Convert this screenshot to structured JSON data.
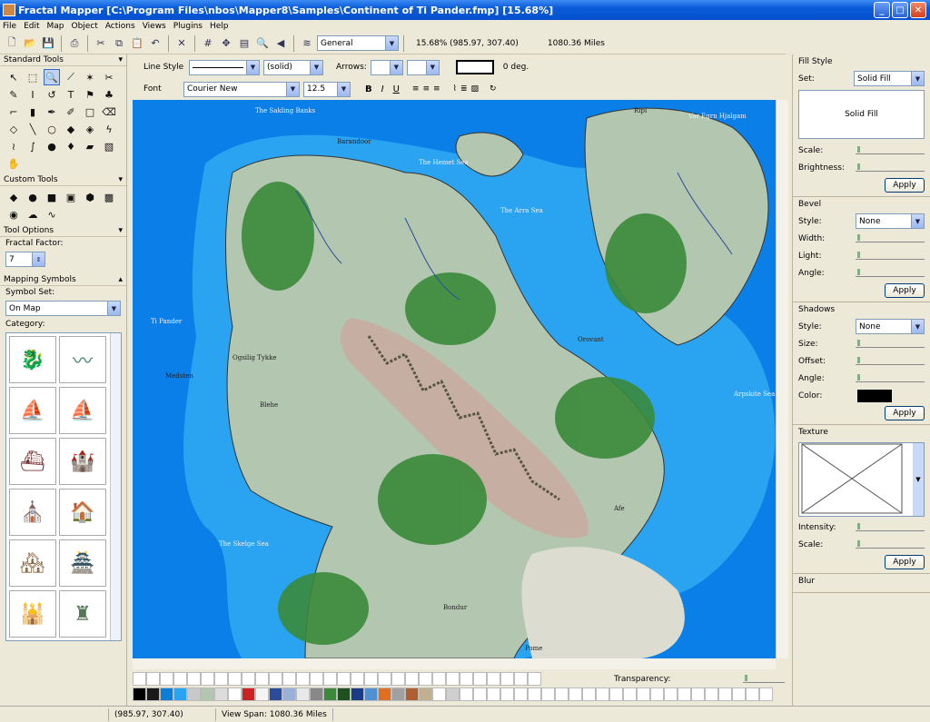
{
  "window": {
    "title": "Fractal Mapper [C:\\Program Files\\nbos\\Mapper8\\Samples\\Continent of Ti Pander.fmp] [15.68%]"
  },
  "menu": [
    "File",
    "Edit",
    "Map",
    "Object",
    "Actions",
    "Views",
    "Plugins",
    "Help"
  ],
  "toolbar": {
    "layer": "General",
    "readout": "15.68%  (985.97, 307.40)",
    "miles": "1080.36 Miles"
  },
  "format": {
    "line_style_label": "Line Style",
    "style_value": "(solid)",
    "arrows_label": "Arrows:",
    "angle": "0 deg.",
    "font_label": "Font",
    "font_value": "Courier New",
    "size_value": "12.5"
  },
  "left": {
    "standard_tools": "Standard Tools",
    "custom_tools": "Custom Tools",
    "tool_options": "Tool Options",
    "fractal_factor": "Fractal Factor:",
    "fractal_value": "7",
    "mapping_symbols": "Mapping Symbols",
    "symbol_set_label": "Symbol Set:",
    "symbol_set_value": "On Map",
    "category_label": "Category:",
    "favorite": "favorite",
    "random": "random"
  },
  "map_labels": [
    "The Sakling Banks",
    "Barandoor",
    "The Hemet Sea",
    "The Arra Sea",
    "Var Egrn Hjalgam",
    "Ripi",
    "Ti Pander",
    "Medsten",
    "Ogsilig Tykke",
    "Blehe",
    "Orovant",
    "Arpskite Sea",
    "The Skelge Sea",
    "Afe",
    "Pome",
    "Bondur"
  ],
  "bottom": {
    "transparency": "Transparency:"
  },
  "right": {
    "fill_style": "Fill Style",
    "set_label": "Set:",
    "set_value": "Solid Fill",
    "preview": "Solid Fill",
    "scale": "Scale:",
    "brightness": "Brightness:",
    "apply": "Apply",
    "bevel": "Bevel",
    "style": "Style:",
    "none": "None",
    "width": "Width:",
    "light": "Light:",
    "angle": "Angle:",
    "shadows": "Shadows",
    "size": "Size:",
    "offset": "Offset:",
    "color": "Color:",
    "texture": "Texture",
    "intensity": "Intensity:",
    "blur": "Blur"
  },
  "status": {
    "coords": "(985.97, 307.40)",
    "span": "View Span: 1080.36 Miles"
  },
  "colors": {
    "palette": [
      "#000000",
      "#1a1a1a",
      "#0a7ed8",
      "#2aa4f0",
      "#c8c8c8",
      "#b3c6b0",
      "#dcdcdc",
      "#ffffff",
      "#cc2222",
      "#f4f4f4",
      "#2b4c9c",
      "#9ab0d8",
      "#e8e8e8",
      "#888888",
      "#3a8a3a",
      "#205020",
      "#1a3a8a",
      "#5090d0",
      "#e07020",
      "#a0a0a0",
      "#b06030",
      "#c0b090",
      "#ffffff",
      "#cfcfcf"
    ]
  }
}
